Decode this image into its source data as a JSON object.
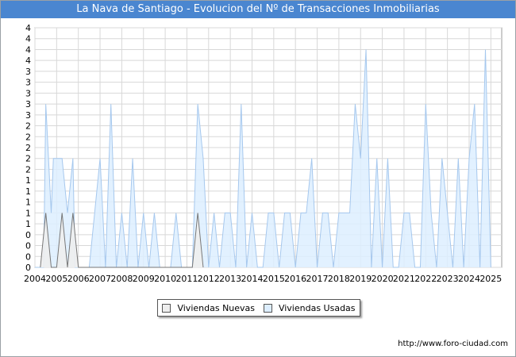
{
  "chart_data": {
    "type": "area",
    "title": "La Nava de Santiago - Evolucion del Nº de Transacciones Inmobiliarias",
    "x_labels": [
      "2004",
      "2005",
      "2006",
      "2007",
      "2008",
      "2009",
      "2010",
      "2011",
      "2012",
      "2013",
      "2014",
      "2015",
      "2016",
      "2017",
      "2018",
      "2019",
      "2020",
      "2021",
      "2022",
      "2023",
      "2024",
      "2025"
    ],
    "x_range": [
      2004,
      2025.5
    ],
    "y_range": [
      0,
      4.4
    ],
    "y_tick_labels": [
      "0",
      "0",
      "0",
      "0",
      "1",
      "1",
      "1",
      "1",
      "1",
      "2",
      "2",
      "2",
      "2",
      "2",
      "3",
      "3",
      "3",
      "3",
      "3",
      "4",
      "4",
      "4",
      "4"
    ],
    "grid": true,
    "legend_position": "bottom",
    "series": [
      {
        "name": "Viviendas Usadas",
        "color": "#a6c8ee",
        "fill": "#ddeeff",
        "points": [
          [
            2004.0,
            0
          ],
          [
            2004.25,
            0
          ],
          [
            2004.4,
            0
          ],
          [
            2004.5,
            3
          ],
          [
            2004.75,
            1
          ],
          [
            2004.85,
            2
          ],
          [
            2005.0,
            2
          ],
          [
            2005.25,
            2
          ],
          [
            2005.5,
            1
          ],
          [
            2005.75,
            2
          ],
          [
            2005.85,
            0
          ],
          [
            2006.0,
            0
          ],
          [
            2006.25,
            0
          ],
          [
            2006.5,
            0
          ],
          [
            2006.75,
            1
          ],
          [
            2007.0,
            2
          ],
          [
            2007.25,
            0
          ],
          [
            2007.5,
            3
          ],
          [
            2007.75,
            0
          ],
          [
            2008.0,
            1
          ],
          [
            2008.25,
            0
          ],
          [
            2008.5,
            2
          ],
          [
            2008.75,
            0
          ],
          [
            2009.0,
            1
          ],
          [
            2009.25,
            0
          ],
          [
            2009.5,
            1
          ],
          [
            2009.75,
            0
          ],
          [
            2010.0,
            0
          ],
          [
            2010.25,
            0
          ],
          [
            2010.5,
            1
          ],
          [
            2010.75,
            0
          ],
          [
            2011.0,
            0
          ],
          [
            2011.25,
            0
          ],
          [
            2011.5,
            3
          ],
          [
            2011.75,
            2
          ],
          [
            2012.0,
            0
          ],
          [
            2012.25,
            1
          ],
          [
            2012.5,
            0
          ],
          [
            2012.75,
            1
          ],
          [
            2013.0,
            1
          ],
          [
            2013.25,
            0
          ],
          [
            2013.5,
            3
          ],
          [
            2013.75,
            0
          ],
          [
            2014.0,
            1
          ],
          [
            2014.25,
            0
          ],
          [
            2014.5,
            0
          ],
          [
            2014.75,
            1
          ],
          [
            2015.0,
            1
          ],
          [
            2015.25,
            0
          ],
          [
            2015.5,
            1
          ],
          [
            2015.75,
            1
          ],
          [
            2016.0,
            0
          ],
          [
            2016.25,
            1
          ],
          [
            2016.5,
            1
          ],
          [
            2016.75,
            2
          ],
          [
            2017.0,
            0
          ],
          [
            2017.25,
            1
          ],
          [
            2017.5,
            1
          ],
          [
            2017.75,
            0
          ],
          [
            2018.0,
            1
          ],
          [
            2018.25,
            1
          ],
          [
            2018.5,
            1
          ],
          [
            2018.75,
            3
          ],
          [
            2019.0,
            2
          ],
          [
            2019.25,
            4
          ],
          [
            2019.5,
            0
          ],
          [
            2019.75,
            2
          ],
          [
            2020.0,
            0
          ],
          [
            2020.25,
            2
          ],
          [
            2020.5,
            0
          ],
          [
            2020.75,
            0
          ],
          [
            2021.0,
            1
          ],
          [
            2021.25,
            1
          ],
          [
            2021.5,
            0
          ],
          [
            2021.75,
            0
          ],
          [
            2022.0,
            3
          ],
          [
            2022.25,
            1
          ],
          [
            2022.5,
            0
          ],
          [
            2022.75,
            2
          ],
          [
            2023.0,
            1
          ],
          [
            2023.25,
            0
          ],
          [
            2023.5,
            2
          ],
          [
            2023.75,
            0
          ],
          [
            2024.0,
            2
          ],
          [
            2024.25,
            3
          ],
          [
            2024.5,
            0
          ],
          [
            2024.75,
            4
          ],
          [
            2025.0,
            0
          ]
        ]
      },
      {
        "name": "Viviendas Nuevas",
        "color": "#777777",
        "fill": "#eeeeee",
        "points": [
          [
            2004.25,
            0
          ],
          [
            2004.5,
            1
          ],
          [
            2004.75,
            0
          ],
          [
            2005.0,
            0
          ],
          [
            2005.25,
            1
          ],
          [
            2005.5,
            0
          ],
          [
            2005.75,
            1
          ],
          [
            2006.0,
            0
          ],
          [
            2011.25,
            0
          ],
          [
            2011.5,
            1
          ],
          [
            2011.75,
            0
          ]
        ]
      }
    ],
    "legend": [
      "Viviendas Nuevas",
      "Viviendas Usadas"
    ],
    "source": "http://www.foro-ciudad.com"
  }
}
